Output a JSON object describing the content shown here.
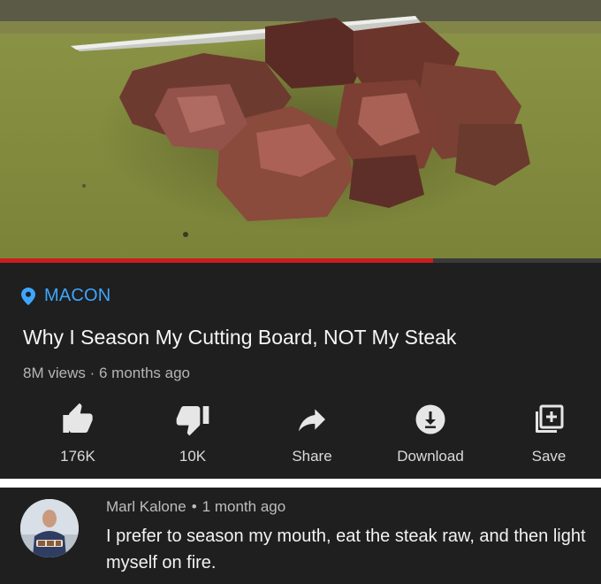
{
  "video": {
    "progress_fraction": 0.72,
    "progress_color": "#c81e1e"
  },
  "location": {
    "icon": "location-pin-icon",
    "text": "MACON",
    "color": "#3ea6ff"
  },
  "title": "Why I Season My Cutting Board, NOT My Steak",
  "meta": {
    "views": "8M views",
    "separator": "·",
    "age": "6 months ago"
  },
  "actions": [
    {
      "icon": "thumbs-up-icon",
      "label": "176K"
    },
    {
      "icon": "thumbs-down-icon",
      "label": "10K"
    },
    {
      "icon": "share-icon",
      "label": "Share"
    },
    {
      "icon": "download-icon",
      "label": "Download"
    },
    {
      "icon": "save-icon",
      "label": "Save"
    }
  ],
  "comment": {
    "author": "Marl Kalone",
    "separator": "•",
    "time": "1 month ago",
    "text": "I prefer to season my mouth, eat the steak raw, and then light myself on fire."
  }
}
